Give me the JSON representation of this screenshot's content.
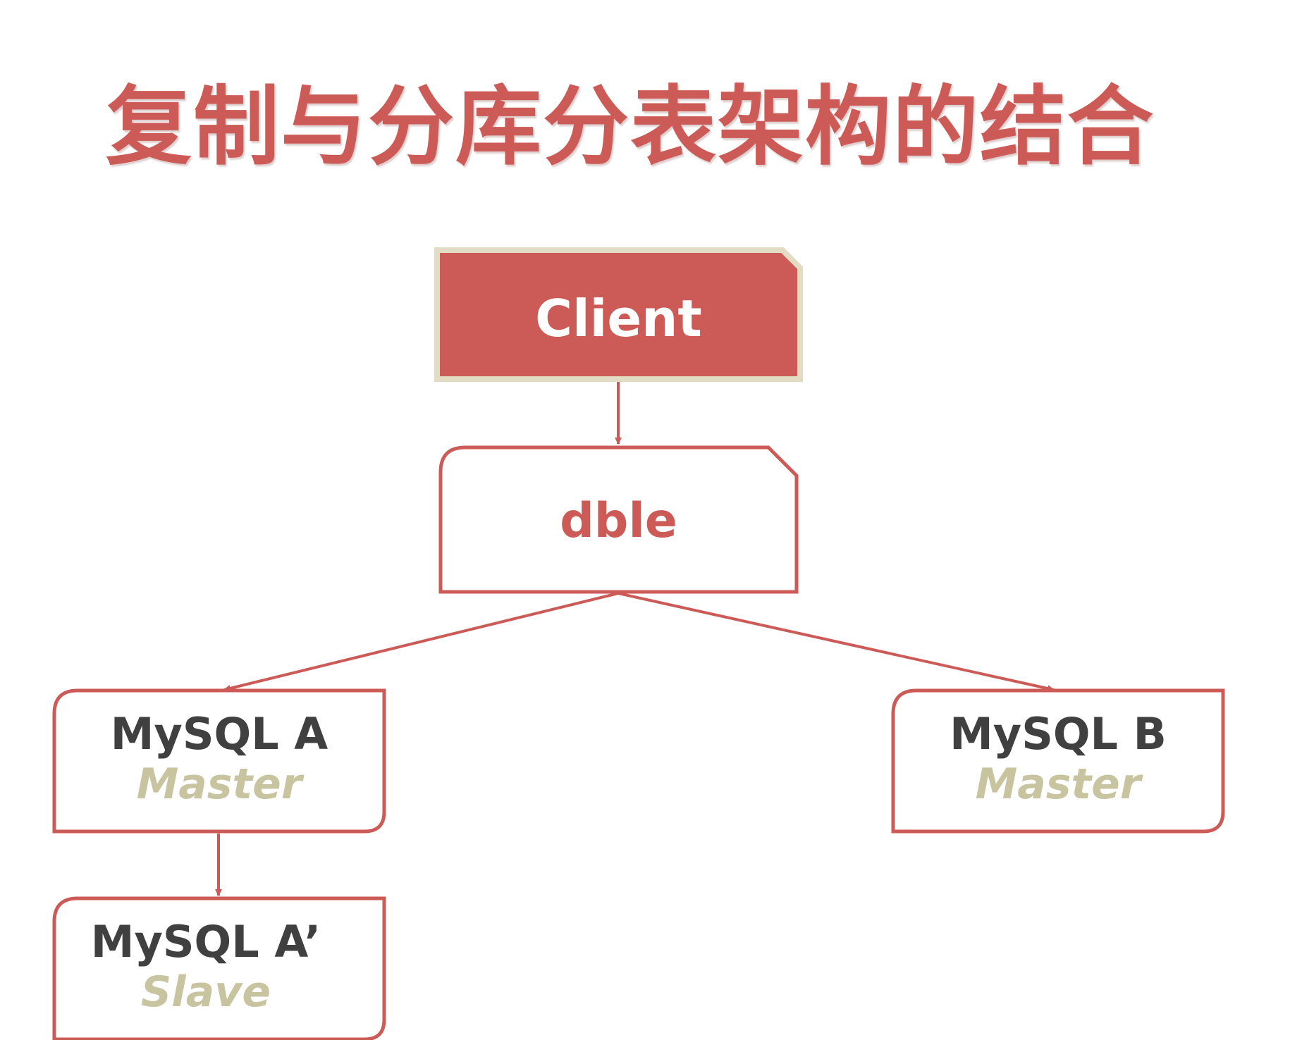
{
  "title": "复制与分库分表架构的结合",
  "colors": {
    "accent": "#cc5b57",
    "role_text": "#c8c4a0",
    "name_text": "#404040",
    "client_border": "#e2dcc4"
  },
  "nodes": {
    "client": {
      "name": "Client"
    },
    "dble": {
      "name": "dble"
    },
    "mysql_a": {
      "name": "MySQL A",
      "role": "Master"
    },
    "mysql_b": {
      "name": "MySQL B",
      "role": "Master"
    },
    "mysql_a_slave": {
      "name": "MySQL A’",
      "role": "Slave"
    }
  }
}
